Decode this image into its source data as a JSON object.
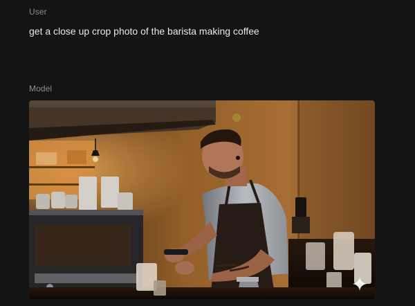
{
  "conversation": {
    "user_turn": {
      "role_label": "User",
      "prompt": "get a close up crop photo of the barista making coffee"
    },
    "model_turn": {
      "role_label": "Model",
      "image": {
        "subject": "barista-making-coffee-photo",
        "badge_icon": "sparkle-icon"
      }
    }
  },
  "colors": {
    "background": "#141414",
    "role_label": "#8d8d8d",
    "prompt_text": "#e9e9e9"
  }
}
